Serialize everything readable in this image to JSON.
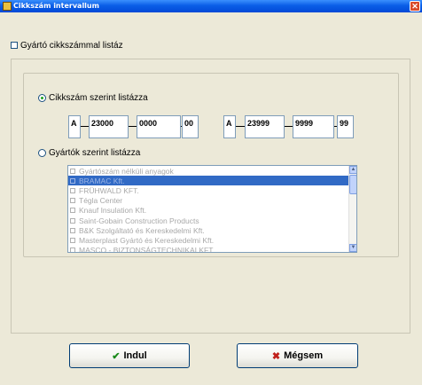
{
  "window": {
    "title": "Cikkszám intervallum",
    "close_symbol": "✕"
  },
  "options": {
    "manufacturer_code_checkbox": "Gyártó cikkszámmal listáz"
  },
  "range": {
    "label": "Cikkszám szerint listázza",
    "from": {
      "prefix": "A",
      "part1": "23000",
      "part2": "0000",
      "part3": "00"
    },
    "to": {
      "prefix": "A",
      "part1": "23999",
      "part2": "9999",
      "part3": "99"
    }
  },
  "manufacturers": {
    "label": "Gyártók szerint listázza",
    "items": [
      "Gyártószám nélküli anyagok",
      "BRAMAC Kft.",
      "FRÜHWALD KFT.",
      "Tégla Center",
      "Knauf Insulation Kft.",
      "Saint-Gobain Construction Products",
      "B&K Szolgáltató és Kereskedelmi Kft.",
      "Masterplast Gyártó és Kereskedelmi Kft.",
      "MASCO - BIZTONSÁGTECHNIKAI KFT."
    ],
    "selected_index": 1
  },
  "buttons": {
    "start_label": "Indul",
    "cancel_label": "Mégsem"
  },
  "icons": {
    "start": "check-icon",
    "cancel": "x-icon"
  },
  "colors": {
    "title_bar": "#0a5ee7",
    "selection": "#316ac5",
    "start_icon": "#1a8a1a",
    "cancel_icon": "#c0201a"
  }
}
